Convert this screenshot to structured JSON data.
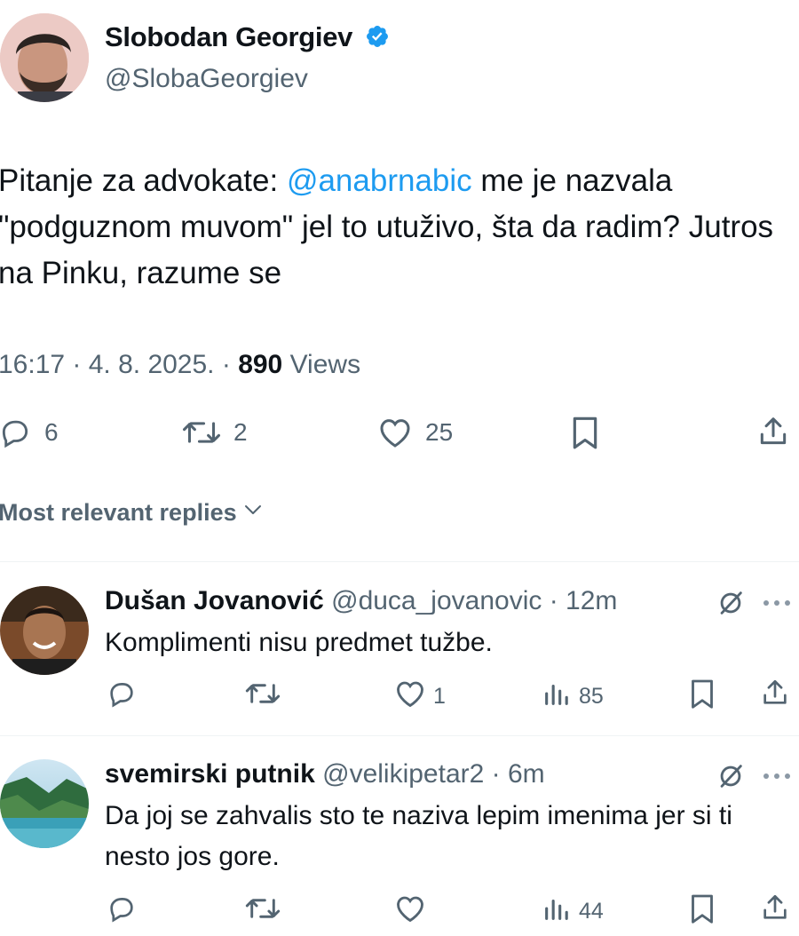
{
  "tweet": {
    "author_name": "Slobodan Georgiev",
    "author_handle": "@SlobaGeorgiev",
    "text_before": "Pitanje za advokate: ",
    "mention": "@anabrnabic",
    "text_after": " me je nazvala \"podguznom muvom\" jel to utuživo, šta da radim? Jutros na Pinku, razume se",
    "time": "16:17 · 4. 8. 2025. · ",
    "views_count": "890",
    "views_label": " Views",
    "replies": "6",
    "retweets": "2",
    "likes": "25"
  },
  "replies_section": {
    "title": "Most relevant replies"
  },
  "replies": [
    {
      "name": "Dušan Jovanović",
      "handle": "@duca_jovanovic",
      "time": "12m",
      "text": "Komplimenti nisu predmet tužbe.",
      "likes": "1",
      "views": "85"
    },
    {
      "name": "svemirski putnik",
      "handle": "@velikipetar2",
      "time": "6m",
      "text": "Da joj se zahvalis sto te naziva lepim imenima jer si ti nesto jos gore.",
      "likes": "",
      "views": "44"
    }
  ],
  "colors": {
    "accent": "#1d9bf0",
    "secondary_text": "#536471",
    "primary_text": "#0f1419",
    "divider": "#eff3f4"
  },
  "icons": [
    "verified-badge-icon",
    "reply-icon",
    "retweet-icon",
    "like-icon",
    "bookmark-icon",
    "share-icon",
    "views-icon",
    "grok-icon",
    "more-icon",
    "chevron-down-icon"
  ]
}
